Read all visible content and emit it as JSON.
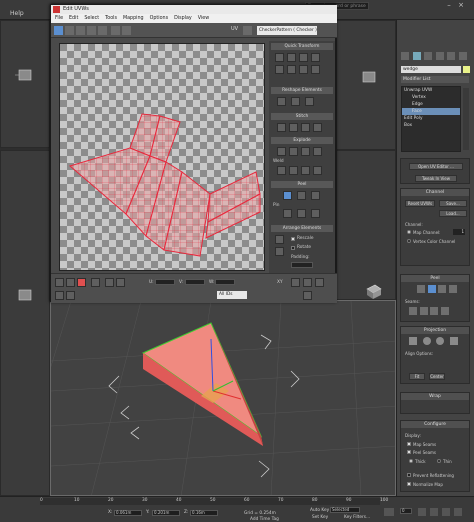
{
  "app": {
    "menu_help": "Help",
    "search_placeholder": "Type a keyword or phrase"
  },
  "uv_editor": {
    "title": "Edit UVWs",
    "menus": [
      "File",
      "Edit",
      "Select",
      "Tools",
      "Mapping",
      "Options",
      "Display",
      "View"
    ],
    "uv_label": "UV",
    "pattern_dropdown": "CheckerPattern  ( Checker )",
    "sections": {
      "quick_transform": "Quick Transform",
      "reshape": "Reshape Elements",
      "stitch": "Stitch",
      "explode": "Explode",
      "weld": "Weld",
      "peel": "Peel",
      "pin": "Pin",
      "arrange": "Arrange Elements",
      "rescale": "Rescale",
      "rotate": "Rotate",
      "padding": "Padding:"
    },
    "bottom": {
      "all_ids": "All IDs",
      "u_label": "U:",
      "v_label": "V:",
      "w_label": "W:",
      "xy_label": "XY"
    }
  },
  "command_panel": {
    "object_name": "wedge",
    "modifier_list": "Modifier List",
    "stack": [
      "Unwrap UVW",
      "Vertex",
      "Edge",
      "Face",
      "Edit Poly",
      "Box"
    ],
    "stack_selected": "Face",
    "open_uv_editor": "Open UV Editor ...",
    "tweak_in_view": "Tweak In View",
    "channel_head": "Channel",
    "reset_uvws": "Reset UVWs",
    "save": "Save...",
    "load": "Load...",
    "channel_label": "Channel:",
    "map_channel": "Map Channel:",
    "map_channel_value": "1",
    "vertex_color_channel": "Vertex Color Channel",
    "peel_head": "Peel",
    "seams": "Seams:",
    "projection_head": "Projection",
    "align_options": "Align Options:",
    "fit": "Fit",
    "center": "Center",
    "wrap_head": "Wrap",
    "configure_head": "Configure",
    "display": "Display:",
    "map_seams": "Map Seams",
    "peel_seams": "Peel Seams",
    "thick": "Thick",
    "thin": "Thin",
    "prevent_reflattening": "Prevent Reflattening",
    "normalize_map": "Normalize Map"
  },
  "status": {
    "x_label": "X:",
    "x_value": "0.061m",
    "y_label": "Y:",
    "y_value": "0.201m",
    "z_label": "Z:",
    "z_value": "0.16m",
    "grid": "Grid = 0.254m",
    "add_time_tag": "Add Time Tag",
    "auto_key": "Auto Key",
    "selected": "Selected",
    "set_key": "Set Key",
    "key_filters": "Key Filters...",
    "frame": "0",
    "timeline_ticks": [
      "0",
      "10",
      "20",
      "30",
      "40",
      "50",
      "60",
      "70",
      "80",
      "90",
      "100"
    ]
  },
  "colors": {
    "uv_wire": "#e8283c",
    "wedge_face": "#f08a80",
    "wedge_side": "#e05a58",
    "selected_row": "#6b8fb8"
  }
}
